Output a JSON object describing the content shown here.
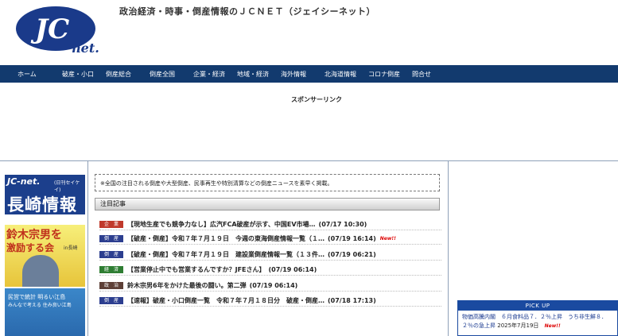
{
  "header": {
    "logo_text": "JC",
    "logo_sub": "net.",
    "site_title": "政治経済・時事・倒産情報のＪＣＮＥＴ（ジェイシーネット）"
  },
  "nav": {
    "items": [
      "ホーム",
      "破産・小口",
      "倒産総合",
      "倒産全国",
      "企業・経済",
      "地域・経済",
      "海外情報",
      "北海道情報",
      "コロナ倒産",
      "問合せ"
    ]
  },
  "sponsor": {
    "label": "スポンサーリンク"
  },
  "left_banners": {
    "nagasaki_top": "JC-net.",
    "nagasaki_sub": "(日刊セイケイ)",
    "nagasaki_main": "長崎情報",
    "suzuki_line1": "鈴木宗男を",
    "suzuki_line2": "激励する会",
    "suzuki_region": "in長崎",
    "bottom_line1": "民営で統計 明るい江島",
    "bottom_line2": "みんなで考える 住み良い江島"
  },
  "main": {
    "notice": "※全国の注目される倒産や大型倒産、民事再生や特別清算などの倒産ニュースを素早く掲載。",
    "section_title": "注目記事",
    "articles": [
      {
        "badge": "企　業",
        "badge_color": "#c0392b",
        "title": "【現地生産でも競争力なし】広汽FCA破産が示す、中国EV市場…",
        "date": "(07/17 10:30)",
        "new": ""
      },
      {
        "badge": "倒　産",
        "badge_color": "#2c3e8f",
        "title": "【破産・倒産】令和７年７月１９日　今週の東海倒産情報一覧（１…",
        "date": "(07/19 16:14)",
        "new": "New!!"
      },
      {
        "badge": "倒　産",
        "badge_color": "#2c3e8f",
        "title": "【破産・倒産】令和７年７月１９日　建設業倒産情報一覧（１３件…",
        "date": "(07/19 06:21)",
        "new": ""
      },
      {
        "badge": "経　済",
        "badge_color": "#2e7d32",
        "title": "【営業停止中でも営業するんですか？JFEさん】",
        "date": "(07/19 06:14)",
        "new": ""
      },
      {
        "badge": "政　治",
        "badge_color": "#5d4037",
        "title": "鈴木宗男6年をかけた最後の闘い。第二弾",
        "date": "(07/19 06:14)",
        "new": ""
      },
      {
        "badge": "倒　産",
        "badge_color": "#2c3e8f",
        "title": "【速報】破産・小口倒産一覧　令和７年７月１８日分　破産・倒産…",
        "date": "(07/18 17:13)",
        "new": ""
      }
    ]
  },
  "pickup": {
    "title": "PICK UP",
    "text": "物価高騰内閣　６月食料品７．２％上昇　うち非生鮮８．２％の急上昇",
    "date": "2025年7月19日",
    "new": "New!!"
  }
}
